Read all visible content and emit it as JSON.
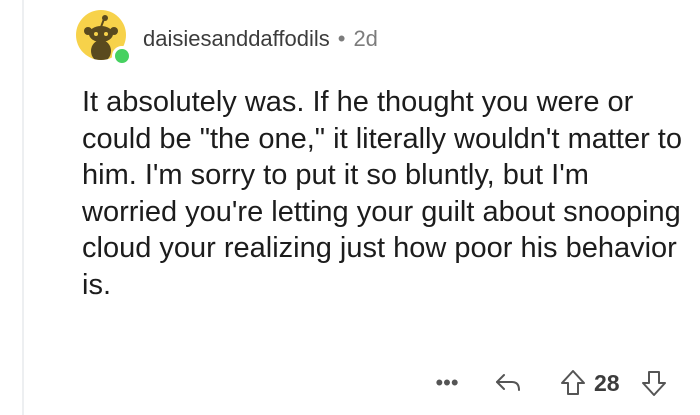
{
  "comment": {
    "username": "daisiesanddaffodils",
    "separator": "•",
    "age": "2d",
    "body": "It absolutely was. If he thought you were or could be \"the one,\" it literally wouldn't matter to him. I'm sorry to put it so bluntly, but I'm worried you're letting your guilt about snooping cloud your realizing just how poor his behavior is.",
    "online": true
  },
  "actions": {
    "more_label": "•••",
    "reply_icon": "reply-arrow-icon",
    "upvote_icon": "upvote-arrow-icon",
    "score": "28",
    "downvote_icon": "downvote-arrow-icon"
  },
  "colors": {
    "avatar_bg": "#f7d24a",
    "online": "#46d160",
    "text": "#1c1c1c",
    "muted": "#7c7c7c"
  }
}
